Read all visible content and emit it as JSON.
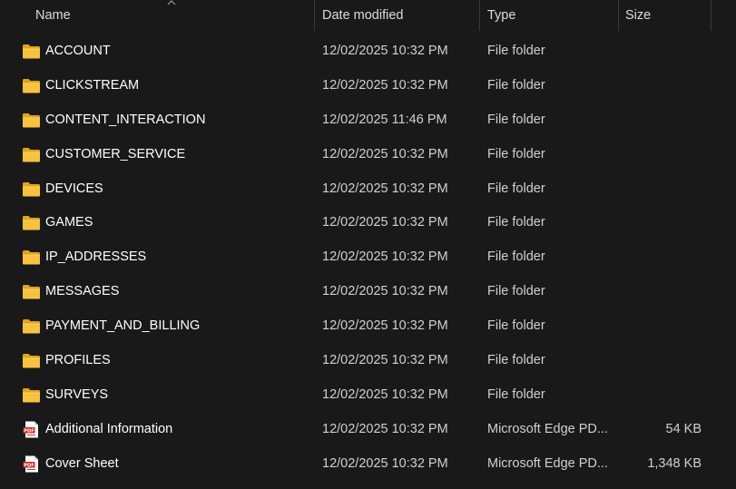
{
  "columns": {
    "name": "Name",
    "date": "Date modified",
    "type": "Type",
    "size": "Size"
  },
  "colors": {
    "background": "#191919",
    "folder": "#f7c23e",
    "folder_dark": "#e0a419",
    "pdf_red": "#c4231f"
  },
  "rows": [
    {
      "name": "ACCOUNT",
      "date": "12/02/2025 10:32 PM",
      "type": "File folder",
      "size": "",
      "icon": "folder-icon"
    },
    {
      "name": "CLICKSTREAM",
      "date": "12/02/2025 10:32 PM",
      "type": "File folder",
      "size": "",
      "icon": "folder-icon"
    },
    {
      "name": "CONTENT_INTERACTION",
      "date": "12/02/2025 11:46 PM",
      "type": "File folder",
      "size": "",
      "icon": "folder-icon"
    },
    {
      "name": "CUSTOMER_SERVICE",
      "date": "12/02/2025 10:32 PM",
      "type": "File folder",
      "size": "",
      "icon": "folder-icon"
    },
    {
      "name": "DEVICES",
      "date": "12/02/2025 10:32 PM",
      "type": "File folder",
      "size": "",
      "icon": "folder-icon"
    },
    {
      "name": "GAMES",
      "date": "12/02/2025 10:32 PM",
      "type": "File folder",
      "size": "",
      "icon": "folder-icon"
    },
    {
      "name": "IP_ADDRESSES",
      "date": "12/02/2025 10:32 PM",
      "type": "File folder",
      "size": "",
      "icon": "folder-icon"
    },
    {
      "name": "MESSAGES",
      "date": "12/02/2025 10:32 PM",
      "type": "File folder",
      "size": "",
      "icon": "folder-icon"
    },
    {
      "name": "PAYMENT_AND_BILLING",
      "date": "12/02/2025 10:32 PM",
      "type": "File folder",
      "size": "",
      "icon": "folder-icon"
    },
    {
      "name": "PROFILES",
      "date": "12/02/2025 10:32 PM",
      "type": "File folder",
      "size": "",
      "icon": "folder-icon"
    },
    {
      "name": "SURVEYS",
      "date": "12/02/2025 10:32 PM",
      "type": "File folder",
      "size": "",
      "icon": "folder-icon"
    },
    {
      "name": "Additional Information",
      "date": "12/02/2025 10:32 PM",
      "type": "Microsoft Edge PD...",
      "size": "54 KB",
      "icon": "pdf-icon"
    },
    {
      "name": "Cover Sheet",
      "date": "12/02/2025 10:32 PM",
      "type": "Microsoft Edge PD...",
      "size": "1,348 KB",
      "icon": "pdf-icon"
    }
  ]
}
